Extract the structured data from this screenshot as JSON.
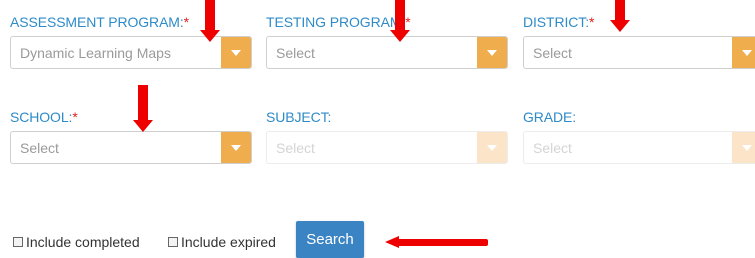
{
  "filters": {
    "assessment_program": {
      "label": "ASSESSMENT PROGRAM:",
      "required_mark": "*",
      "value": "Dynamic Learning Maps"
    },
    "testing_program": {
      "label": "TESTING PROGRAM:",
      "required_mark": "*",
      "value": "Select"
    },
    "district": {
      "label": "DISTRICT:",
      "required_mark": "*",
      "value": "Select"
    },
    "school": {
      "label": "SCHOOL:",
      "required_mark": "*",
      "value": "Select"
    },
    "subject": {
      "label": "SUBJECT:",
      "value": "Select",
      "disabled": true
    },
    "grade": {
      "label": "GRADE:",
      "value": "Select",
      "disabled": true
    }
  },
  "options": {
    "include_completed": {
      "label": "Include completed",
      "checked": false
    },
    "include_expired": {
      "label": "Include expired",
      "checked": false
    }
  },
  "actions": {
    "search_label": "Search"
  },
  "colors": {
    "label": "#2e8bc9",
    "required": "#e02020",
    "dropdown_button": "#f0ad4e",
    "search_button": "#3a84c4",
    "annotation_arrow": "#ee0000"
  }
}
